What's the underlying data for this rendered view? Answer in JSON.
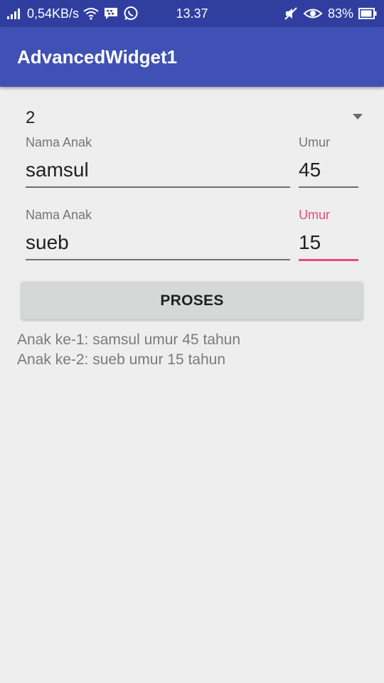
{
  "status_bar": {
    "speed": "0,54KB/s",
    "time": "13.37",
    "battery": "83%",
    "icons": [
      "signal-icon",
      "wifi-icon",
      "bbm-icon",
      "whatsapp-icon",
      "mute-icon",
      "eye-icon",
      "battery-icon"
    ]
  },
  "app_bar": {
    "title": "AdvancedWidget1",
    "color": "#3f51b5"
  },
  "spinner": {
    "selected": "2"
  },
  "children": [
    {
      "name_label": "Nama Anak",
      "name_value": "samsul",
      "age_label": "Umur",
      "age_value": "45"
    },
    {
      "name_label": "Nama Anak",
      "name_value": "sueb",
      "age_label": "Umur",
      "age_value": "15"
    }
  ],
  "accent_color": "#e94a7f",
  "button": {
    "label": "PROSES"
  },
  "results": [
    "Anak ke-1: samsul umur 45 tahun",
    "Anak ke-2: sueb umur 15 tahun"
  ]
}
